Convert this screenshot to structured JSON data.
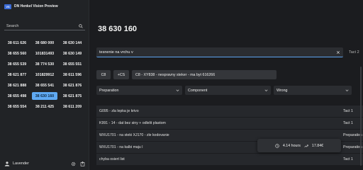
{
  "app": {
    "title": "DN Henkel Vision Preview",
    "logo_text": "VS"
  },
  "sidebar": {
    "search_placeholder": "Search",
    "items": [
      {
        "label": "38 611 626",
        "selected": false
      },
      {
        "label": "38 680 000",
        "selected": false
      },
      {
        "label": "38 630 144",
        "selected": false
      },
      {
        "label": "38 655 560",
        "selected": false
      },
      {
        "label": "101831493",
        "selected": false
      },
      {
        "label": "38 630 149",
        "selected": false
      },
      {
        "label": "38 655 539",
        "selected": false
      },
      {
        "label": "38 774 530",
        "selected": false
      },
      {
        "label": "38 655 551",
        "selected": false
      },
      {
        "label": "38 621 877",
        "selected": false
      },
      {
        "label": "101829912",
        "selected": false
      },
      {
        "label": "38 611 596",
        "selected": false
      },
      {
        "label": "38 621 888",
        "selected": false
      },
      {
        "label": "38 655 541",
        "selected": false
      },
      {
        "label": "38 621 876",
        "selected": false
      },
      {
        "label": "38 655 498",
        "selected": false
      },
      {
        "label": "38 630 160",
        "selected": true
      },
      {
        "label": "38 621 875",
        "selected": false
      },
      {
        "label": "38 655 554",
        "selected": false
      },
      {
        "label": "38 211 425",
        "selected": false
      },
      {
        "label": "38 611 209",
        "selected": false
      }
    ],
    "footer": {
      "user_name": "Lavender"
    }
  },
  "main": {
    "number": "38 630 160",
    "text_input_value": "tesnenie na vrchu v",
    "right_tag": "Tact 2",
    "chips": [
      "C8",
      "+CS",
      "C8 - XY838 - nespravny steker - ma byt 616266"
    ],
    "selects": [
      "Preparation",
      "Component",
      "Wrong"
    ],
    "rows": [
      {
        "desc": "G095 - zla lepka je krivo",
        "cat": "Tact 1"
      },
      {
        "desc": "K991 - 14 - dat bez siny + odlelit plastom",
        "cat": "Tact 1"
      },
      {
        "desc": "WXU1701 - na steki XJ170 - zle kodovanie",
        "cat": "Preparation"
      },
      {
        "desc": "WXU1701 - na kalbi maju l",
        "cat": "Preparation"
      },
      {
        "desc": "chyba osiert list",
        "cat": "Tact 1"
      }
    ],
    "toast": {
      "hours": "4.14 hours",
      "amount": "17.84€"
    }
  },
  "colors": {
    "accent": "#5fa9f2",
    "sidebar_bg": "#212326",
    "main_bg": "#1b1c1f"
  }
}
